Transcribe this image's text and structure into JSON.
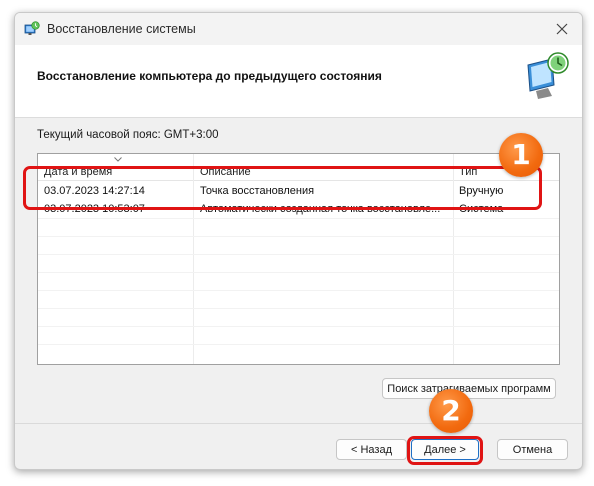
{
  "window": {
    "title": "Восстановление системы",
    "header_title": "Восстановление компьютера до предыдущего состояния",
    "timezone_label": "Текущий часовой пояс: GMT+3:00"
  },
  "table": {
    "columns": [
      "Дата и время",
      "Описание",
      "Тип"
    ],
    "rows": [
      {
        "date": "03.07.2023 14:27:14",
        "description": "Точка восстановления",
        "type": "Вручную"
      },
      {
        "date": "03.07.2023 10:53:07",
        "description": "Автоматически созданная точка восстановле...",
        "type": "Система"
      }
    ]
  },
  "buttons": {
    "scan": "Поиск затрагиваемых программ",
    "back": "< Назад",
    "next": "Далее >",
    "cancel": "Отмена"
  },
  "annotations": {
    "badge1": "1",
    "badge2": "2"
  },
  "colors": {
    "highlight": "#e01414",
    "badge": "#f26a0f",
    "default_button_border": "#1f6fc5"
  },
  "icons": {
    "title": "system-restore-icon",
    "header": "restore-monitor-icon",
    "close": "close-icon"
  }
}
